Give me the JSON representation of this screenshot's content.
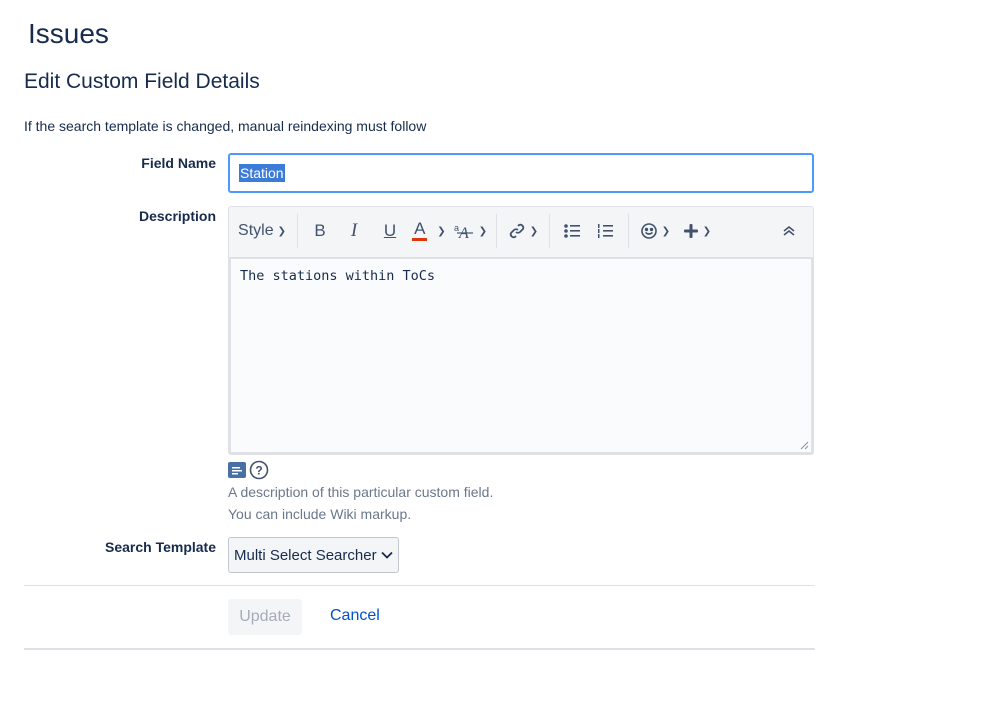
{
  "page_title": "Issues",
  "section_title": "Edit Custom Field Details",
  "notice": "If the search template is changed, manual reindexing must follow",
  "field_name": {
    "label": "Field Name",
    "value": "Station"
  },
  "description": {
    "label": "Description",
    "value": "The stations within ToCs",
    "toolbar": {
      "style_label": "Style",
      "bold": "B",
      "italic": "I",
      "underline": "U",
      "text_color": "A",
      "text_color_accent": "#de350b",
      "icons": [
        "text-effects-icon",
        "link-icon",
        "bullet-list-icon",
        "numbered-list-icon",
        "emoji-icon",
        "insert-plus-icon",
        "collapse-toolbar-icon"
      ]
    },
    "help_line_1": "A description of this particular custom field.",
    "help_line_2": "You can include Wiki markup."
  },
  "search_template": {
    "label": "Search Template",
    "selected": "Multi Select Searcher"
  },
  "buttons": {
    "update": "Update",
    "cancel": "Cancel"
  },
  "colors": {
    "focus_border": "#4c9aff",
    "link": "#0052cc",
    "selection": "#3d7bd9"
  }
}
